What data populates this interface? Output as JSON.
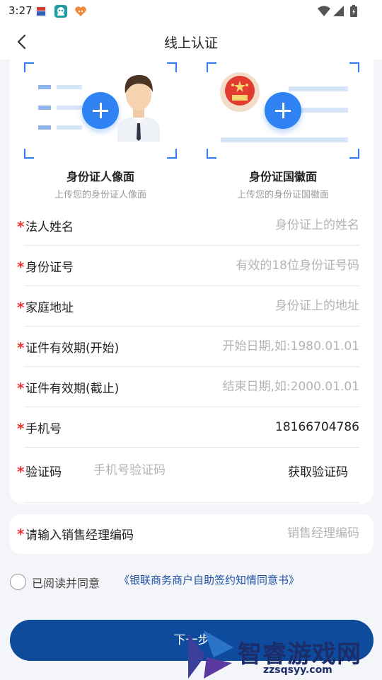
{
  "status_bar": {
    "time": "3:27",
    "icons": [
      "app-notification-icon-1",
      "app-notification-icon-2",
      "app-notification-icon-3",
      "wifi-icon",
      "signal-icon",
      "battery-icon"
    ]
  },
  "header": {
    "title": "线上认证",
    "back_icon": "chevron-left-icon"
  },
  "uploads": {
    "portrait": {
      "title": "身份证人像面",
      "subtitle": "上传您的身份证人像面"
    },
    "emblem": {
      "title": "身份证国徽面",
      "subtitle": "上传您的身份证国徽面"
    }
  },
  "form": {
    "fields": [
      {
        "label": "法人姓名",
        "placeholder": "身份证上的姓名",
        "value": ""
      },
      {
        "label": "身份证号",
        "placeholder": "有效的18位身份证号码",
        "value": ""
      },
      {
        "label": "家庭地址",
        "placeholder": "身份证上的地址",
        "value": ""
      },
      {
        "label": "证件有效期(开始)",
        "placeholder": "开始日期,如:1980.01.01",
        "value": ""
      },
      {
        "label": "证件有效期(截止)",
        "placeholder": "结束日期,如:2000.01.01",
        "value": ""
      },
      {
        "label": "手机号",
        "placeholder": "",
        "value": "18166704786"
      }
    ],
    "verification": {
      "label": "验证码",
      "placeholder": "手机号验证码",
      "button": "获取验证码"
    },
    "required_mark": "*"
  },
  "manager": {
    "label": "请输入销售经理编码",
    "placeholder": "销售经理编码"
  },
  "agreement": {
    "text": "已阅读并同意",
    "link": "《银联商务商户自助签约知情同意书》",
    "checked": false
  },
  "next_button": {
    "label": "下一步"
  },
  "watermark": {
    "text": "智睿游戏网",
    "url": "zzsqsyy.com"
  },
  "colors": {
    "primary": "#0e4b9c",
    "accent": "#2e82f2",
    "required": "#e8332e",
    "link": "#1e4fa5",
    "placeholder": "#b4b4b4"
  }
}
